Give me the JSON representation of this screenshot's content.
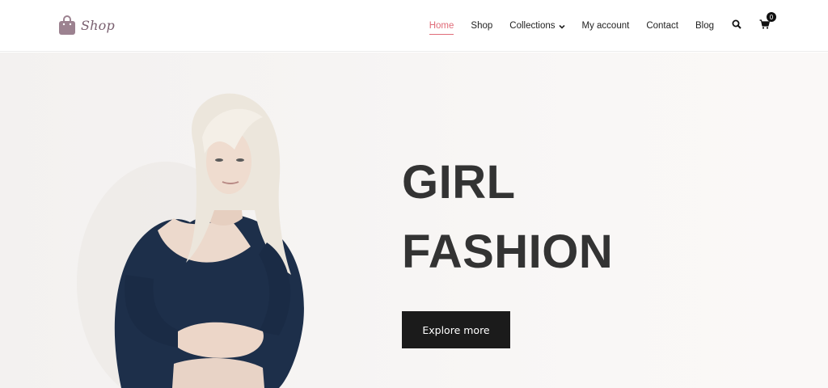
{
  "header": {
    "logo_text": "Shop",
    "nav": [
      {
        "label": "Home",
        "active": true
      },
      {
        "label": "Shop"
      },
      {
        "label": "Collections",
        "has_dropdown": true
      },
      {
        "label": "My account"
      },
      {
        "label": "Contact"
      },
      {
        "label": "Blog"
      }
    ],
    "cart_count": "0",
    "icons": [
      "shopping-bag-icon",
      "chevron-down-icon",
      "search-icon",
      "cart-icon"
    ]
  },
  "hero": {
    "title_line1": "GIRL",
    "title_line2": "FASHION",
    "button_label": "Explore more"
  },
  "colors": {
    "accent": "#e06b78",
    "logo": "#9c8290",
    "title": "#333333",
    "button_bg": "#1b1b1b",
    "hero_bg": "#f5f3f2"
  }
}
